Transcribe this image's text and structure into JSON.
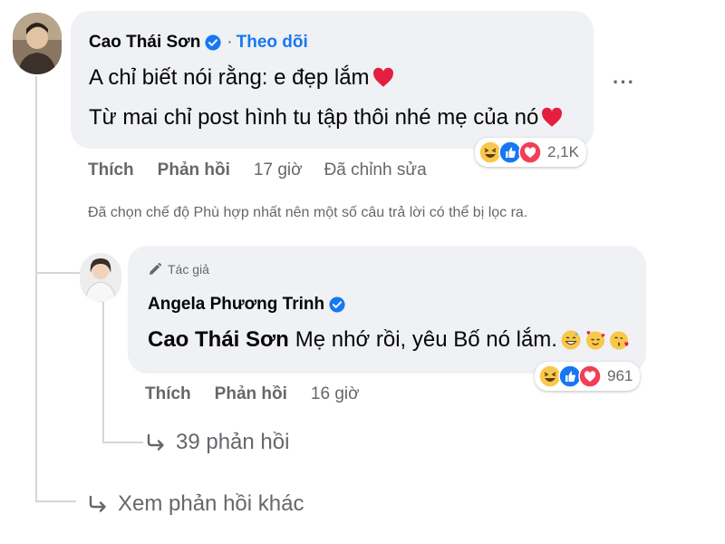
{
  "comment": {
    "author": "Cao Thái Sơn",
    "follow_separator": "·",
    "follow_label": "Theo dõi",
    "line1": "A chỉ biết nói rằng: e đẹp lắm",
    "line2": "Từ mai chỉ post hình tu tập thôi nhé mẹ của nó",
    "more_options": "···",
    "reaction_icons": [
      "haha-icon",
      "like-icon",
      "love-icon"
    ],
    "reaction_count": "2,1K",
    "actions": {
      "like": "Thích",
      "reply": "Phản hồi",
      "time": "17 giờ",
      "edited": "Đã chỉnh sửa"
    }
  },
  "filter_note": "Đã chọn chế độ Phù hợp nhất nên một số câu trả lời có thể bị lọc ra.",
  "reply": {
    "author_tag": "Tác giả",
    "author": "Angela Phương Trinh",
    "mention": "Cao Thái Sơn",
    "text": "Mẹ nhớ rồi, yêu Bố nó lắm.",
    "emojis": [
      "grin-sweat-icon",
      "smiling-hearts-icon",
      "kissing-heart-icon"
    ],
    "reaction_icons": [
      "haha-icon",
      "like-icon",
      "love-icon"
    ],
    "reaction_count": "961",
    "actions": {
      "like": "Thích",
      "reply": "Phản hồi",
      "time": "16 giờ"
    },
    "replies_link": "39 phản hồi"
  },
  "more_replies": "Xem phản hồi khác",
  "colors": {
    "bubble": "#eff1f4",
    "link_blue": "#1877f2",
    "secondary_text": "#65676b",
    "heart_red": "#e41e3f"
  }
}
